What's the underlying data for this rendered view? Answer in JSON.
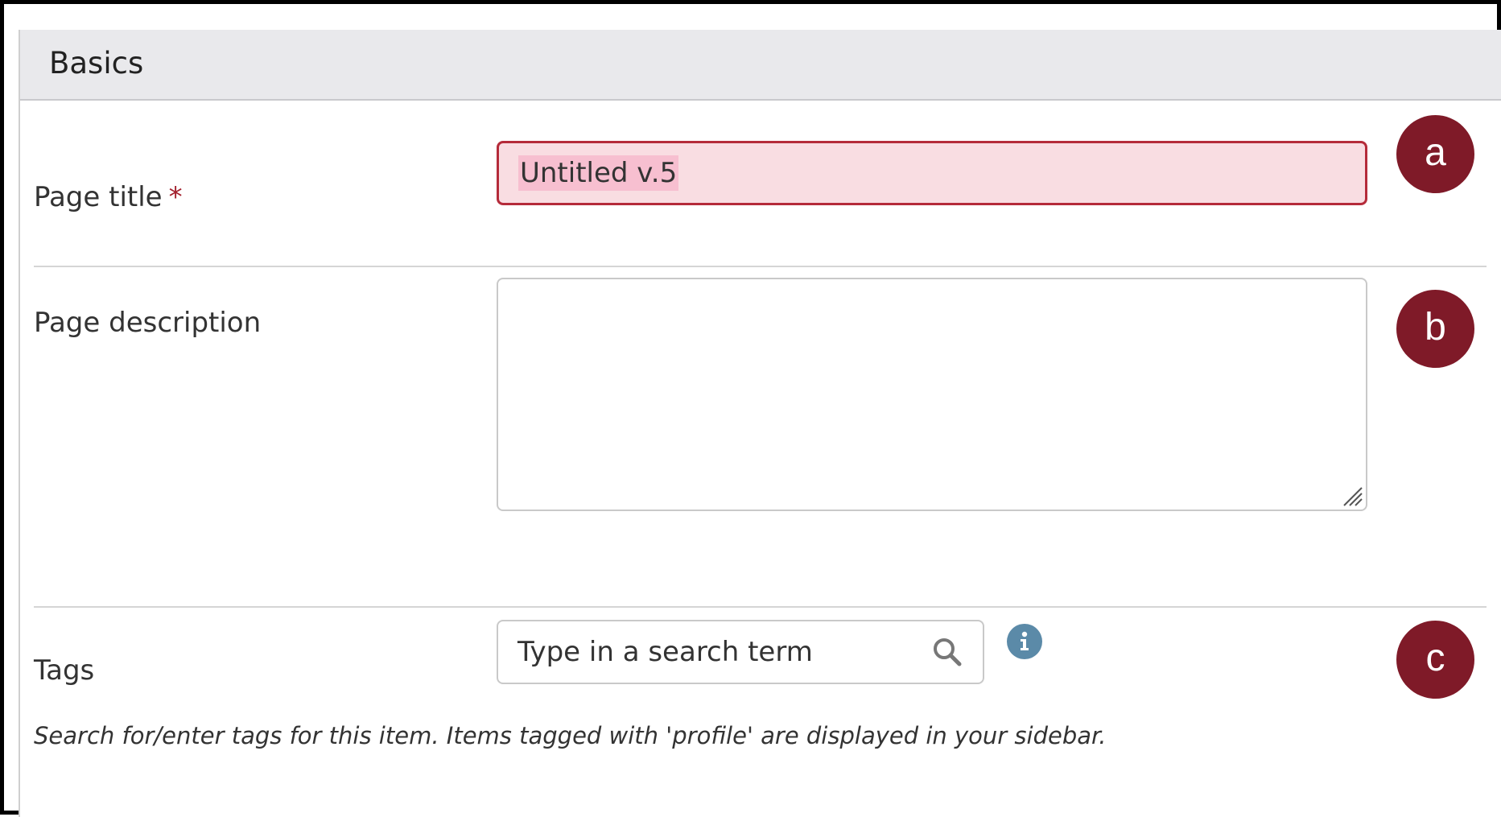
{
  "section": {
    "title": "Basics"
  },
  "fields": {
    "page_title": {
      "label": "Page title",
      "required_marker": "*",
      "value": "Untitled v.5"
    },
    "page_description": {
      "label": "Page description",
      "value": ""
    },
    "tags": {
      "label": "Tags",
      "placeholder": "Type in a search term",
      "help_text": "Search for/enter tags for this item. Items tagged with 'profile' are displayed in your sidebar."
    }
  },
  "callouts": [
    "a",
    "b",
    "c"
  ],
  "icons": {
    "search": "search-icon",
    "info": "info-icon",
    "resize": "resize-grip-icon"
  },
  "colors": {
    "accent": "#7f1a28",
    "error_border": "#b52b3a",
    "error_background": "#f9dde2",
    "info": "#5b8aa8",
    "header_background": "#e9e9ec"
  }
}
